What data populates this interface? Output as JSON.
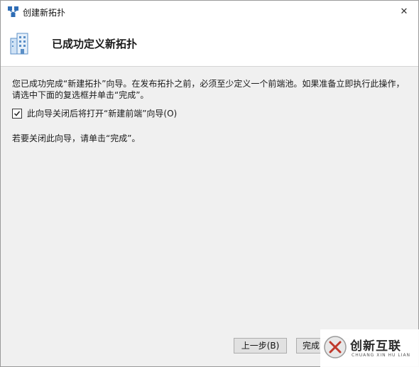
{
  "window": {
    "title": "创建新拓扑",
    "close_glyph": "✕"
  },
  "header": {
    "title": "已成功定义新拓扑"
  },
  "content": {
    "description": "您已成功完成“新建拓扑”向导。在发布拓扑之前，必须至少定义一个前端池。如果准备立即执行此操作，请选中下面的复选框并单击“完成”。",
    "checkbox_label": "此向导关闭后将打开“新建前端”向导(O)",
    "checkbox_checked": true,
    "finish_note": "若要关闭此向导，请单击“完成”。"
  },
  "footer": {
    "back_label": "上一步(B)",
    "finish_label": "完成"
  },
  "watermark": {
    "brand": "创新互联",
    "sub": "CHUANG XIN HU LIAN"
  }
}
